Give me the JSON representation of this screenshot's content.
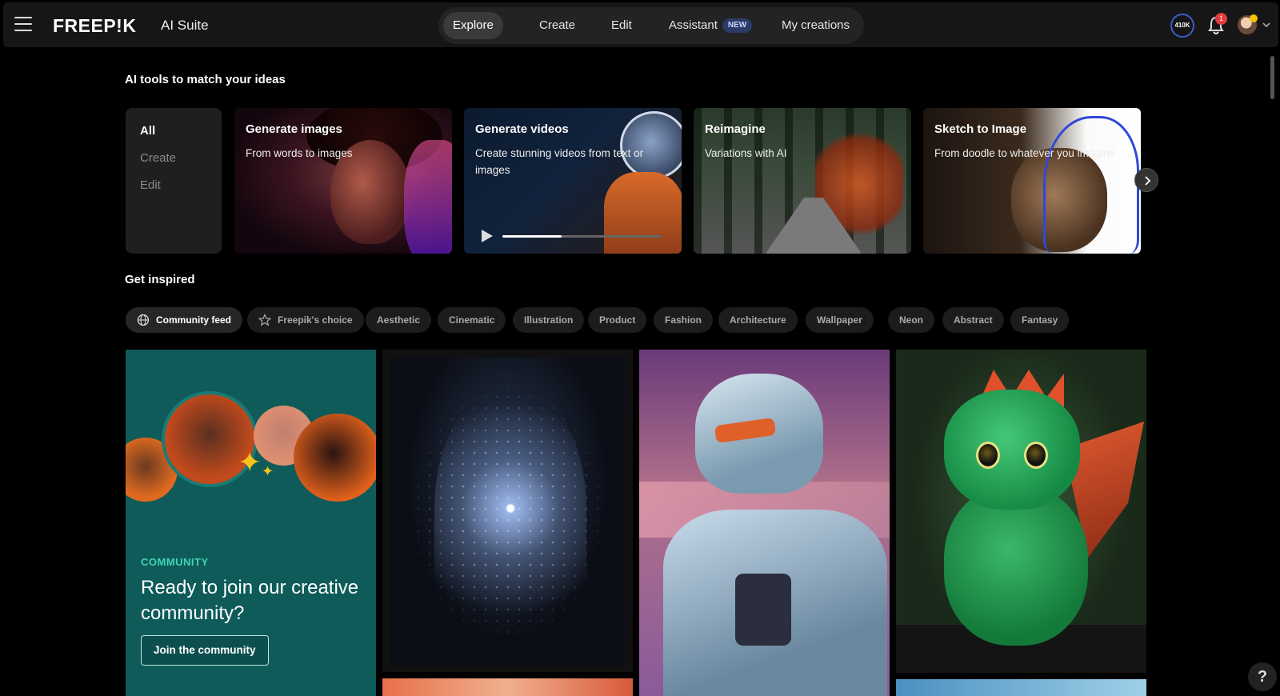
{
  "header": {
    "logo": "FREEP!K",
    "suite": "AI Suite",
    "nav": [
      {
        "label": "Explore",
        "active": true
      },
      {
        "label": "Create"
      },
      {
        "label": "Edit"
      },
      {
        "label": "Assistant",
        "badge": "NEW"
      },
      {
        "label": "My creations"
      }
    ],
    "credits": "410K",
    "notifications": "1"
  },
  "tools": {
    "title": "AI tools to match your ideas",
    "categories": [
      "All",
      "Create",
      "Edit"
    ],
    "cards": [
      {
        "title": "Generate images",
        "subtitle": "From words to images"
      },
      {
        "title": "Generate videos",
        "subtitle": "Create stunning videos from text or images",
        "progress": 0.37
      },
      {
        "title": "Reimagine",
        "subtitle": "Variations with AI"
      },
      {
        "title": "Sketch to Image",
        "subtitle": "From doodle to whatever you imagine"
      }
    ]
  },
  "inspired": {
    "title": "Get inspired",
    "chips": [
      "Community feed",
      "Freepik's choice",
      "Aesthetic",
      "Cinematic",
      "Illustration",
      "Product",
      "Fashion",
      "Architecture",
      "Wallpaper",
      "Neon",
      "Abstract",
      "Fantasy"
    ]
  },
  "community": {
    "label": "COMMUNITY",
    "headline": "Ready to join our creative community?",
    "button": "Join the community"
  },
  "help": "?",
  "colors": {
    "accent_teal": "#0e5b59",
    "badge_blue": "#2b3b66",
    "notif_red": "#e53a3a"
  }
}
